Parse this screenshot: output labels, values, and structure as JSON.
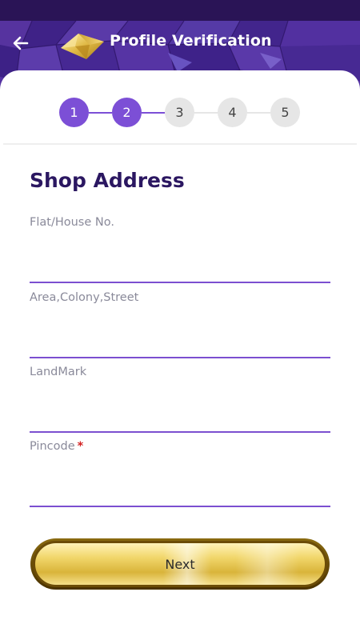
{
  "header": {
    "title": "Profile Verification"
  },
  "stepper": {
    "steps": [
      "1",
      "2",
      "3",
      "4",
      "5"
    ],
    "current_step": 2
  },
  "form": {
    "section_title": "Shop Address",
    "fields": {
      "flat_house": {
        "label": "Flat/House No.",
        "value": ""
      },
      "area_colony": {
        "label": "Area,Colony,Street",
        "value": ""
      },
      "landmark": {
        "label": "LandMark",
        "value": ""
      },
      "pincode": {
        "label": "Pincode",
        "required_mark": "*",
        "value": ""
      }
    }
  },
  "actions": {
    "next_label": "Next"
  },
  "colors": {
    "primary": "#7c4fd6",
    "header_bg": "#4a2a9a",
    "status_bar": "#2a1456",
    "title_dark": "#2b1761",
    "required": "#d32222",
    "gold": "#e8c64e"
  }
}
